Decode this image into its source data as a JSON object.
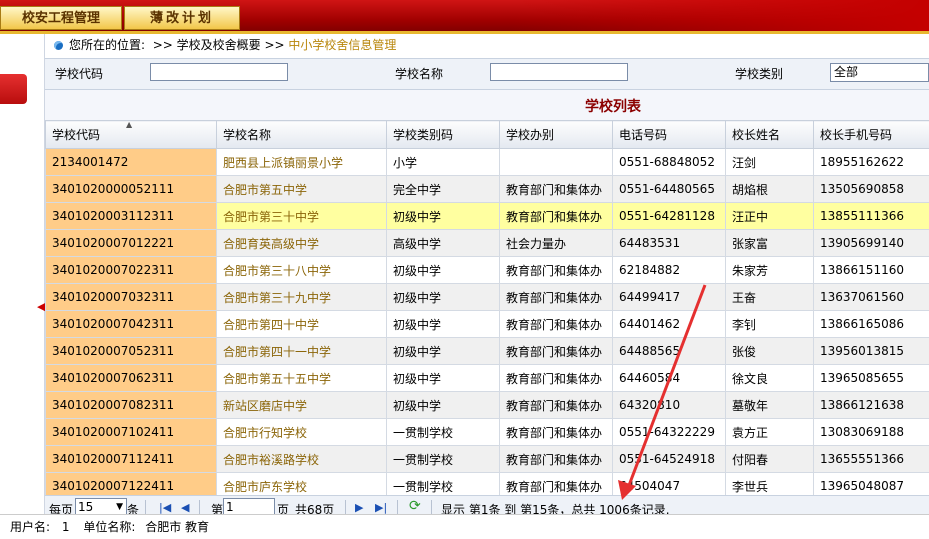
{
  "header": {
    "tab1": "校安工程管理",
    "tab2": "薄改计划"
  },
  "breadcrumb": {
    "prefix": "您所在的位置:",
    "sep1": ">>",
    "item1": "学校及校舍概要",
    "sep2": ">>",
    "item2": "中小学校舍信息管理"
  },
  "filters": {
    "code_label": "学校代码",
    "code_value": "",
    "name_label": "学校名称",
    "name_value": "",
    "type_label": "学校类别",
    "type_value": "全部"
  },
  "list_title": "学校列表",
  "columns": [
    "学校代码",
    "学校名称",
    "学校类别码",
    "学校办别",
    "电话号码",
    "校长姓名",
    "校长手机号码"
  ],
  "rows": [
    [
      "2134001472",
      "肥西县上派镇丽景小学",
      "小学",
      "",
      "0551-68848052",
      "汪剑",
      "18955162622"
    ],
    [
      "3401020000052111",
      "合肥市第五中学",
      "完全中学",
      "教育部门和集体办",
      "0551-64480565",
      "胡焰根",
      "13505690858"
    ],
    [
      "3401020003112311",
      "合肥市第三十中学",
      "初级中学",
      "教育部门和集体办",
      "0551-64281128",
      "汪正中",
      "13855111366"
    ],
    [
      "3401020007012221",
      "合肥育英高级中学",
      "高级中学",
      "社会力量办",
      "64483531",
      "张家富",
      "13905699140"
    ],
    [
      "3401020007022311",
      "合肥市第三十八中学",
      "初级中学",
      "教育部门和集体办",
      "62184882",
      "朱家芳",
      "13866151160"
    ],
    [
      "3401020007032311",
      "合肥市第三十九中学",
      "初级中学",
      "教育部门和集体办",
      "64499417",
      "王奋",
      "13637061560"
    ],
    [
      "3401020007042311",
      "合肥市第四十中学",
      "初级中学",
      "教育部门和集体办",
      "64401462",
      "李钊",
      "13866165086"
    ],
    [
      "3401020007052311",
      "合肥市第四十一中学",
      "初级中学",
      "教育部门和集体办",
      "64488565",
      "张俊",
      "13956013815"
    ],
    [
      "3401020007062311",
      "合肥市第五十五中学",
      "初级中学",
      "教育部门和集体办",
      "64460584",
      "徐文良",
      "13965085655"
    ],
    [
      "3401020007082311",
      "新站区磨店中学",
      "初级中学",
      "教育部门和集体办",
      "64320810",
      "墓敬年",
      "13866121638"
    ],
    [
      "3401020007102411",
      "合肥市行知学校",
      "一贯制学校",
      "教育部门和集体办",
      "0551-64322229",
      "袁方正",
      "13083069188"
    ],
    [
      "3401020007112411",
      "合肥市裕溪路学校",
      "一贯制学校",
      "教育部门和集体办",
      "0551-64524918",
      "付阳春",
      "13655551366"
    ],
    [
      "3401020007122411",
      "合肥市庐东学校",
      "一贯制学校",
      "教育部门和集体办",
      "64504047",
      "李世兵",
      "13965048087"
    ]
  ],
  "pager": {
    "per_page_label": "每页",
    "per_page_value": "15",
    "per_page_unit": "条",
    "page_label": "第",
    "page_value": "1",
    "page_unit": "页",
    "total_pages": "共68页",
    "summary": "显示 第1条 到 第15条，总共 1006条记录."
  },
  "status": {
    "user_label": "用户名:",
    "user_value": "1",
    "unit_label": "单位名称:",
    "unit_value": "合肥市 教育"
  },
  "colors": {
    "accent": "#c40000",
    "code_cell": "#ffcc88",
    "highlight_row": "#ffffa0",
    "title_red": "#8b0000"
  }
}
